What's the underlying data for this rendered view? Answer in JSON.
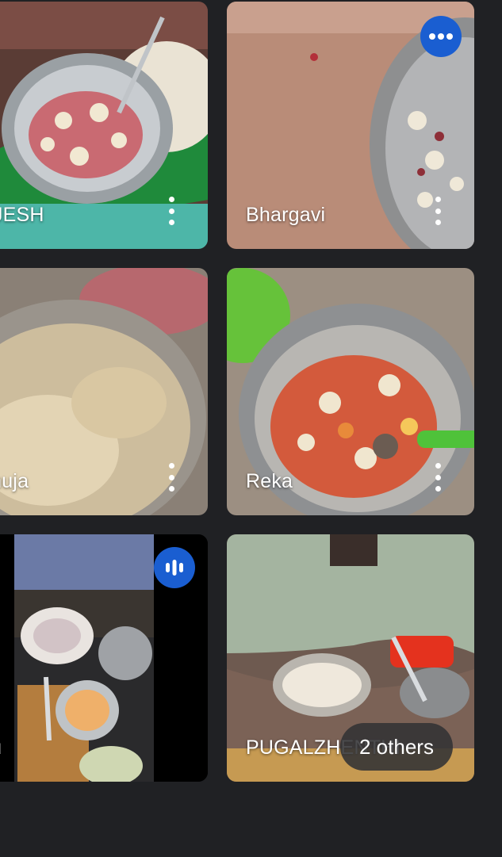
{
  "participants": [
    {
      "name": "AJESH",
      "menu_icon": "more-vert-icon"
    },
    {
      "name": "Bhargavi",
      "menu_icon": "more-vert-icon",
      "badge_icon": "more-horiz-icon"
    },
    {
      "name": "anuja",
      "menu_icon": "more-vert-icon"
    },
    {
      "name": "Reka",
      "menu_icon": "more-vert-icon"
    },
    {
      "name": "ou",
      "badge_icon": "audio-level-icon"
    },
    {
      "name": "PUGALZHENTHI"
    }
  ],
  "others_chip": {
    "label": "2 others"
  },
  "colors": {
    "background": "#202124",
    "badge_blue": "#1a5ed1",
    "chip_bg": "#323234"
  }
}
